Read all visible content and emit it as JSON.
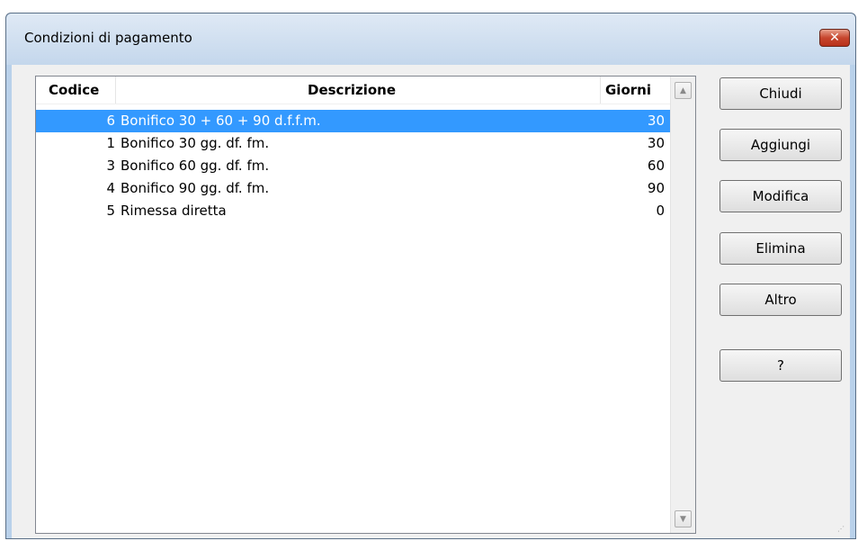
{
  "window": {
    "title": "Condizioni di pagamento",
    "close_label": "✕"
  },
  "table": {
    "columns": [
      "Codice",
      "Descrizione",
      "Giorni"
    ],
    "rows": [
      {
        "code": "6",
        "description": "Bonifico 30 + 60 + 90 d.f.f.m.",
        "days": "30",
        "selected": true
      },
      {
        "code": "1",
        "description": "Bonifico 30 gg. df. fm.",
        "days": "30",
        "selected": false
      },
      {
        "code": "3",
        "description": "Bonifico 60 gg. df. fm.",
        "days": "60",
        "selected": false
      },
      {
        "code": "4",
        "description": "Bonifico 90 gg. df. fm.",
        "days": "90",
        "selected": false
      },
      {
        "code": "5",
        "description": "Rimessa diretta",
        "days": "0",
        "selected": false
      }
    ]
  },
  "buttons": {
    "close": "Chiudi",
    "add": "Aggiungi",
    "edit": "Modifica",
    "delete": "Elimina",
    "other": "Altro",
    "help": "?"
  },
  "colors": {
    "selection": "#3399ff",
    "frame": "#b9d1ea",
    "client": "#f0f0f0"
  }
}
